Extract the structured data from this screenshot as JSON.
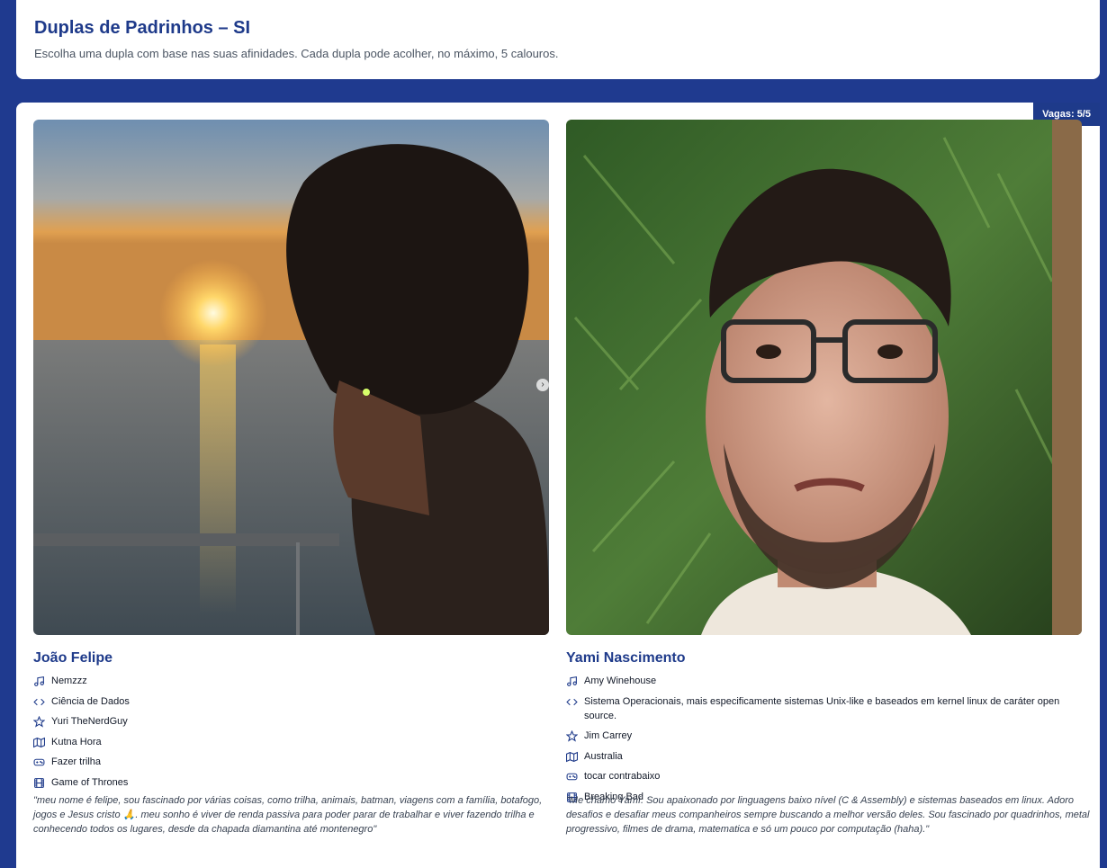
{
  "header": {
    "title": "Duplas de Padrinhos – SI",
    "subtitle": "Escolha uma dupla com base nas suas afinidades. Cada dupla pode acolher, no máximo, 5 calouros."
  },
  "pair": {
    "vagas": "Vagas: 5/5",
    "people": [
      {
        "name": "João Felipe",
        "facts": [
          {
            "icon": "music-icon",
            "text": "Nemzzz"
          },
          {
            "icon": "code-icon",
            "text": "Ciência de Dados"
          },
          {
            "icon": "star-icon",
            "text": "Yuri TheNerdGuy"
          },
          {
            "icon": "map-icon",
            "text": "Kutna Hora"
          },
          {
            "icon": "gamepad-icon",
            "text": "Fazer trilha"
          },
          {
            "icon": "film-icon",
            "text": "Game of Thrones"
          }
        ],
        "quote": "\"meu nome é felipe, sou fascinado por várias coisas, como trilha, animais, batman, viagens com a família, botafogo, jogos e Jesus cristo 🙏. meu sonho é viver de renda passiva para poder parar de trabalhar e viver fazendo trilha e conhecendo todos os lugares, desde da chapada diamantina até montenegro\""
      },
      {
        "name": "Yami Nascimento",
        "facts": [
          {
            "icon": "music-icon",
            "text": "Amy Winehouse"
          },
          {
            "icon": "code-icon",
            "text": "Sistema Operacionais, mais especificamente sistemas Unix-like e baseados em kernel linux de caráter open source."
          },
          {
            "icon": "star-icon",
            "text": "Jim Carrey"
          },
          {
            "icon": "map-icon",
            "text": "Australia"
          },
          {
            "icon": "gamepad-icon",
            "text": "tocar contrabaixo"
          },
          {
            "icon": "film-icon",
            "text": "Breaking Bad"
          }
        ],
        "quote": "\"Me chamo Yamí. Sou apaixonado por linguagens baixo nível (C & Assembly) e sistemas baseados em linux. Adoro desafios e desafiar meus companheiros sempre buscando a melhor versão deles. Sou fascinado por quadrinhos, metal progressivo, filmes de drama, matematica e só um pouco por computação (haha).\""
      }
    ]
  },
  "colors": {
    "background": "#1f3a8f",
    "accent": "#1e3a8a"
  }
}
